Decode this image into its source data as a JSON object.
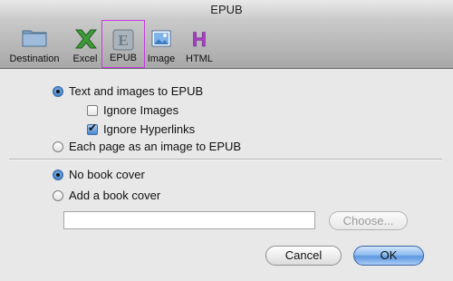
{
  "window": {
    "title": "EPUB"
  },
  "toolbar": {
    "items": [
      {
        "label": "Destination"
      },
      {
        "label": "Excel"
      },
      {
        "label": "EPUB"
      },
      {
        "label": "Image"
      },
      {
        "label": "HTML"
      }
    ],
    "selected": "EPUB"
  },
  "options": {
    "text_images": "Text and images to EPUB",
    "ignore_images": "Ignore Images",
    "ignore_hyperlinks": "Ignore Hyperlinks",
    "page_as_image": "Each page as an image to EPUB",
    "no_cover": "No book cover",
    "add_cover": "Add a book cover",
    "cover_path_value": ""
  },
  "state": {
    "text_images_selected": true,
    "ignore_images_checked": false,
    "ignore_hyperlinks_checked": true,
    "no_cover_selected": true
  },
  "buttons": {
    "choose": "Choose...",
    "cancel": "Cancel",
    "ok": "OK"
  },
  "colors": {
    "selection_outline": "#c43be0",
    "ok_button": "#5d97e0"
  }
}
